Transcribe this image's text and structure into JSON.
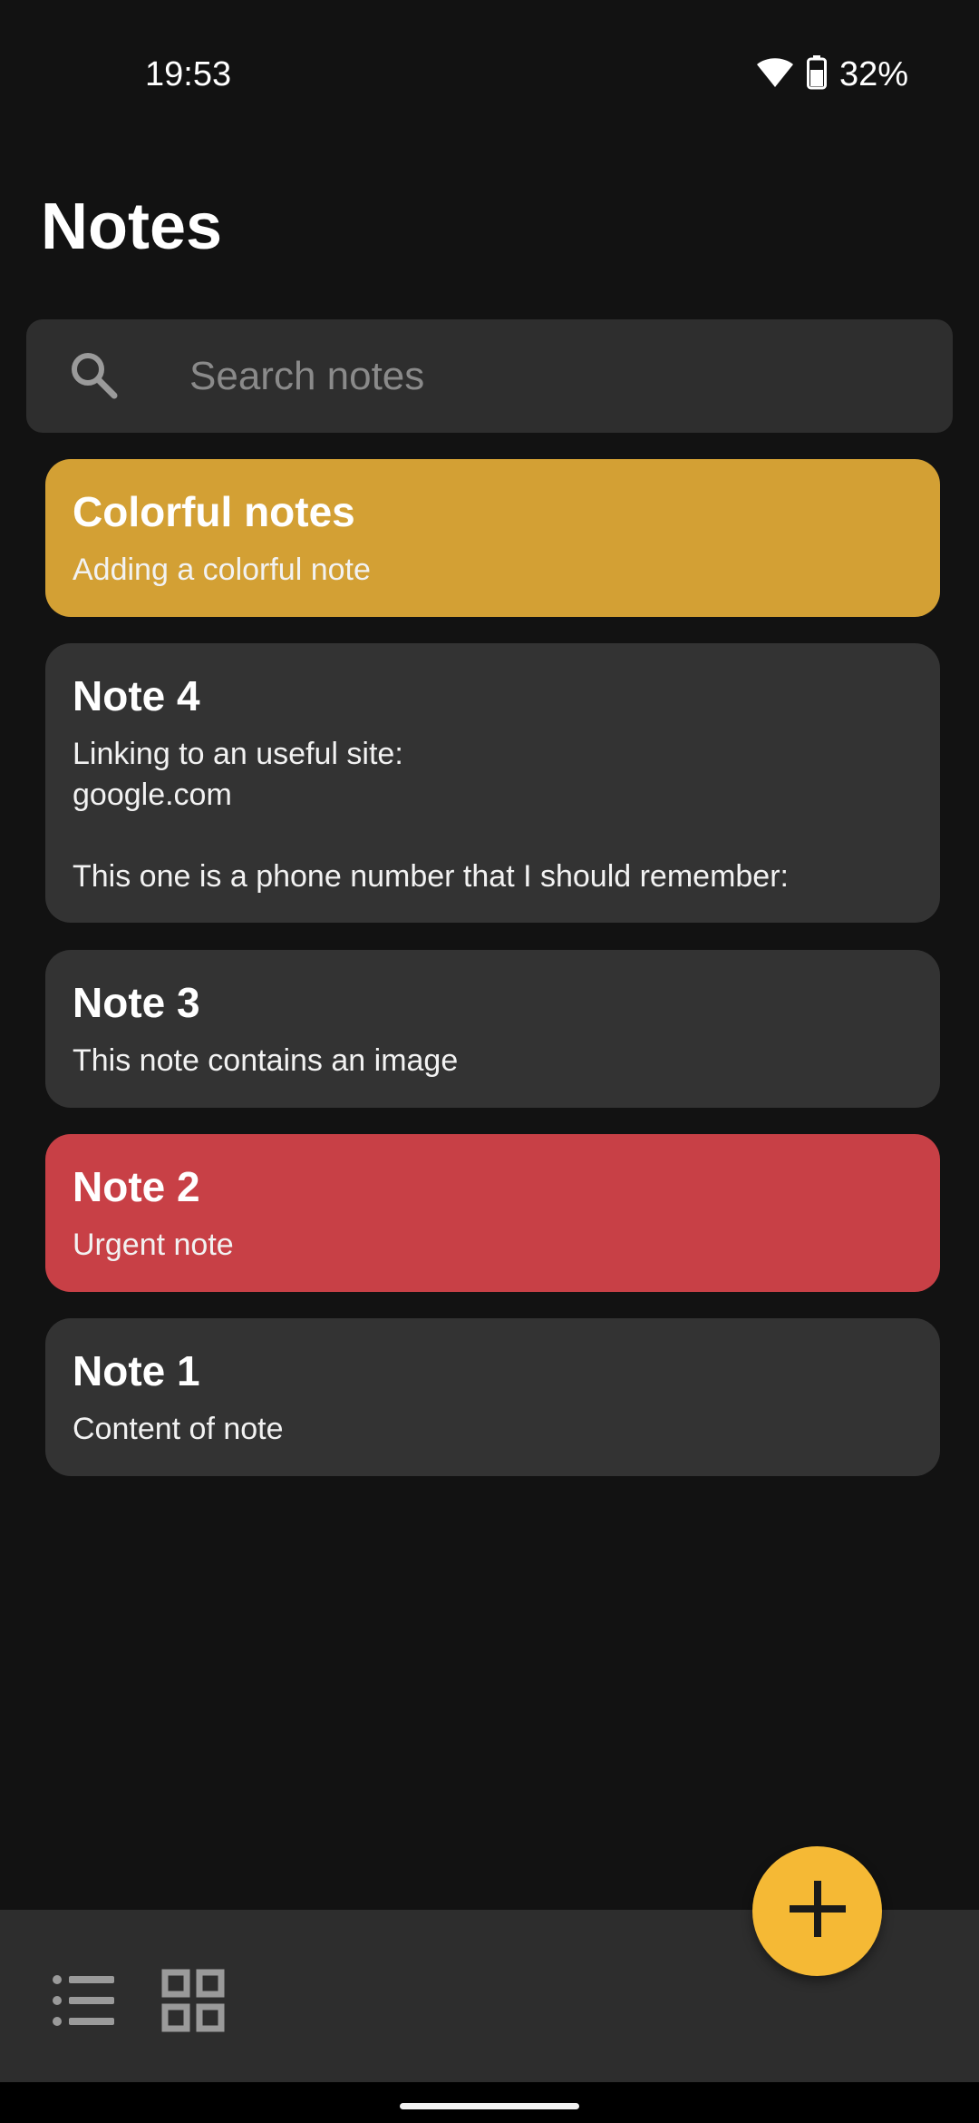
{
  "status_bar": {
    "time": "19:53",
    "battery_percent": "32%",
    "icons": [
      "wifi-icon",
      "battery-icon"
    ]
  },
  "header": {
    "title": "Notes"
  },
  "search": {
    "placeholder": "Search notes",
    "value": ""
  },
  "notes": [
    {
      "title": "Colorful notes",
      "content": "Adding a colorful note",
      "color": "#d3a034"
    },
    {
      "title": "Note 4",
      "content": "Linking to an useful site:\ngoogle.com\n\nThis one is a phone number that I should remember:",
      "color": "#333333"
    },
    {
      "title": "Note 3",
      "content": "This note contains an image",
      "color": "#333333"
    },
    {
      "title": "Note 2",
      "content": "Urgent note",
      "color": "#c84046"
    },
    {
      "title": "Note 1",
      "content": "Content of note",
      "color": "#333333"
    }
  ],
  "bottom_bar": {
    "icons": [
      "list-view-icon",
      "grid-view-icon"
    ]
  },
  "fab": {
    "icon": "plus-icon",
    "color": "#f5b935"
  }
}
